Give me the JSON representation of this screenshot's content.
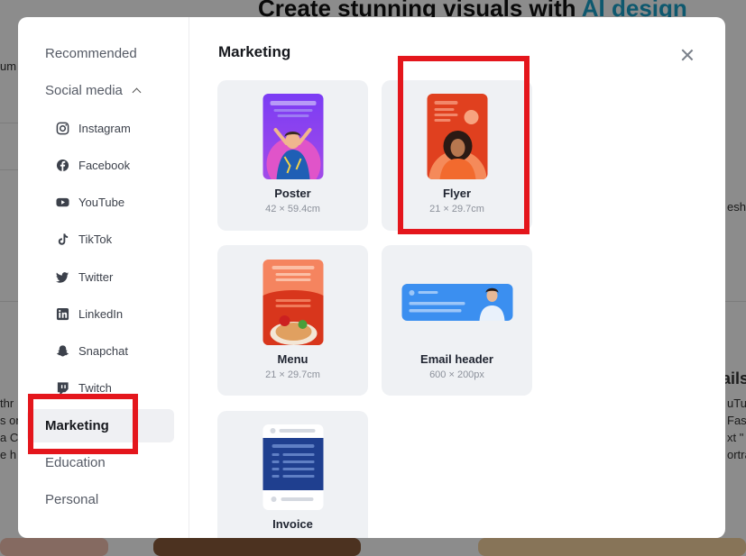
{
  "background": {
    "headline_start": "Create stunning visuals with ",
    "headline_accent": "AI design",
    "left_fragments": [
      "um",
      "thr",
      "s on",
      "a Cl",
      "e h"
    ],
    "right_fragments": [
      "eshi",
      "ails",
      "uTu",
      "Fash",
      "xt \"",
      "ortra"
    ]
  },
  "sidebar": {
    "recommended": "Recommended",
    "social_media": "Social media",
    "social_items": [
      {
        "label": "Instagram",
        "icon": "instagram-icon"
      },
      {
        "label": "Facebook",
        "icon": "facebook-icon"
      },
      {
        "label": "YouTube",
        "icon": "youtube-icon"
      },
      {
        "label": "TikTok",
        "icon": "tiktok-icon"
      },
      {
        "label": "Twitter",
        "icon": "twitter-icon"
      },
      {
        "label": "LinkedIn",
        "icon": "linkedin-icon"
      },
      {
        "label": "Snapchat",
        "icon": "snapchat-icon"
      },
      {
        "label": "Twitch",
        "icon": "twitch-icon"
      }
    ],
    "marketing": "Marketing",
    "education": "Education",
    "personal": "Personal"
  },
  "main": {
    "section_title": "Marketing",
    "cards": [
      {
        "label": "Poster",
        "dims": "42 × 59.4cm"
      },
      {
        "label": "Flyer",
        "dims": "21 × 29.7cm"
      },
      {
        "label": "Menu",
        "dims": "21 × 29.7cm"
      },
      {
        "label": "Email header",
        "dims": "600 × 200px"
      },
      {
        "label": "Invoice",
        "dims": ""
      }
    ]
  },
  "colors": {
    "highlight": "#e4161c",
    "poster_purple": "#8a3df2",
    "flyer_red": "#e0401f",
    "menu_orange": "#f0603a",
    "email_blue": "#3b8ff0",
    "invoice_navy": "#1f3f8f"
  }
}
